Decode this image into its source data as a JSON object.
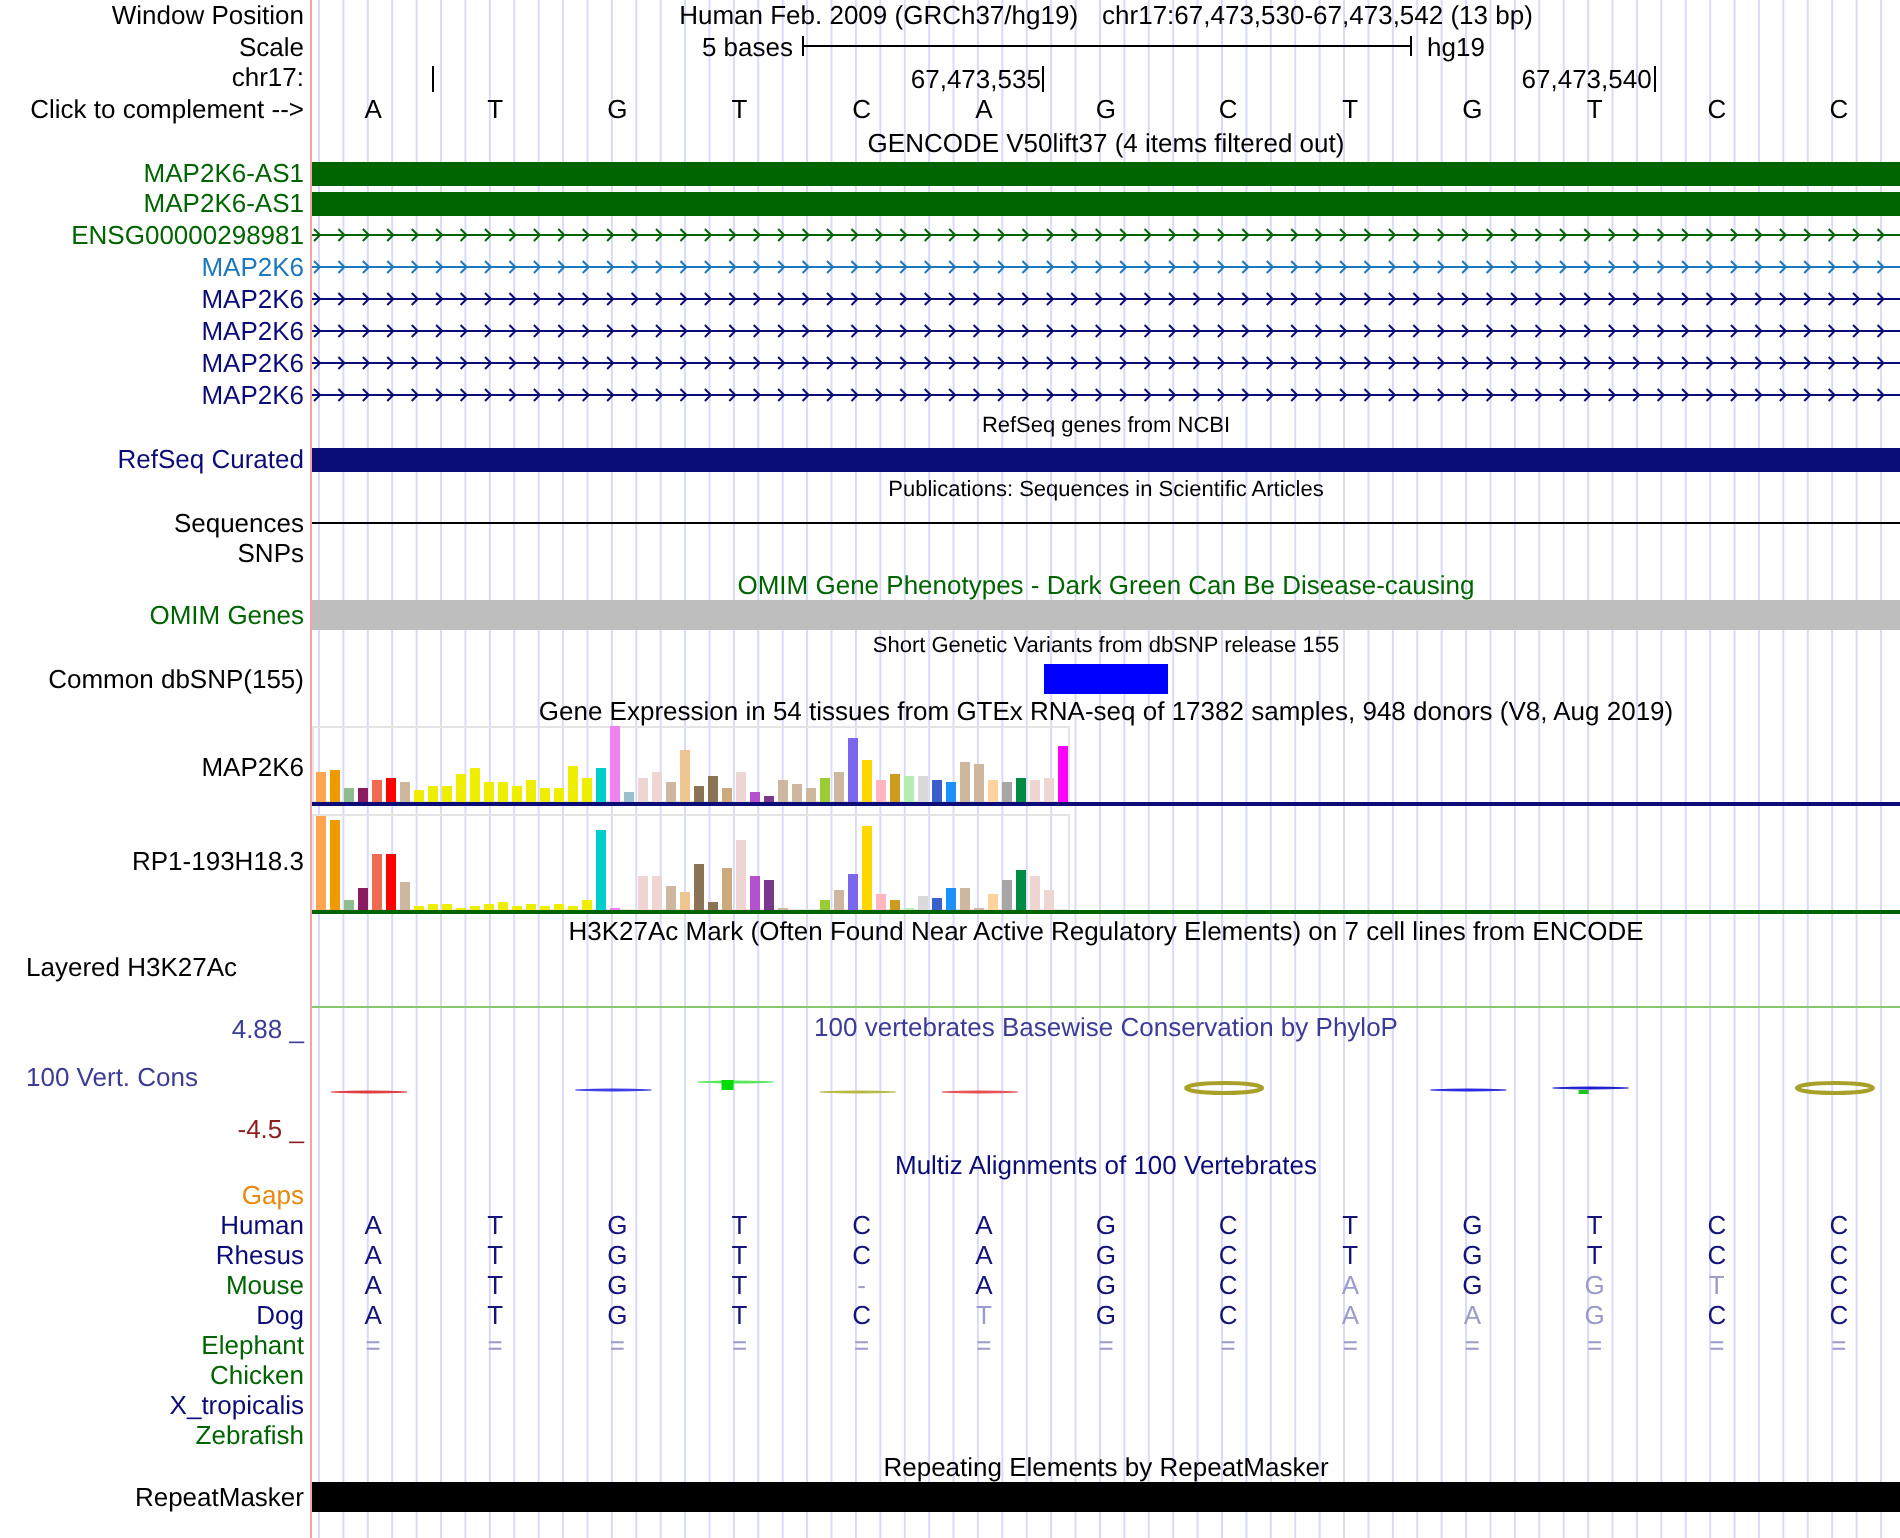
{
  "position": {
    "label": "Window Position",
    "assembly": "Human Feb. 2009 (GRCh37/hg19)",
    "range": "chr17:67,473,530-67,473,542 (13 bp)"
  },
  "scale": {
    "label": "Scale",
    "span": "5 bases",
    "assembly": "hg19"
  },
  "ruler": {
    "label": "chr17:",
    "ticks": [
      "67,473,535",
      "67,473,540"
    ]
  },
  "sequence": {
    "label": "Click to complement -->",
    "bases": [
      "A",
      "T",
      "G",
      "T",
      "C",
      "A",
      "G",
      "C",
      "T",
      "G",
      "T",
      "C",
      "C"
    ]
  },
  "tracks": [
    {
      "kind": "title",
      "text": "GENCODE V50lift37 (4 items filtered out)",
      "color": "#000000"
    },
    {
      "kind": "exon",
      "label": "MAP2K6-AS1",
      "color": "#006400"
    },
    {
      "kind": "exon",
      "label": "MAP2K6-AS1",
      "color": "#006400"
    },
    {
      "kind": "intron",
      "label": "ENSG00000298981",
      "color": "#006400"
    },
    {
      "kind": "intron",
      "label": "MAP2K6",
      "color": "#1e78be"
    },
    {
      "kind": "intron",
      "label": "MAP2K6",
      "color": "#0c0c78"
    },
    {
      "kind": "intron",
      "label": "MAP2K6",
      "color": "#0c0c78"
    },
    {
      "kind": "intron",
      "label": "MAP2K6",
      "color": "#0c0c78"
    },
    {
      "kind": "intron",
      "label": "MAP2K6",
      "color": "#0c0c78"
    },
    {
      "kind": "small_title",
      "text": "RefSeq genes from NCBI",
      "color": "#000000"
    },
    {
      "kind": "exon",
      "label": "RefSeq Curated",
      "color": "#0c0c78"
    },
    {
      "kind": "small_title",
      "text": "Publications: Sequences in Scientific Articles",
      "color": "#000000"
    },
    {
      "kind": "line",
      "label": "Sequences",
      "color": "#000000"
    },
    {
      "kind": "empty",
      "label": "SNPs",
      "color": "#000000"
    },
    {
      "kind": "title",
      "text": "OMIM Gene Phenotypes - Dark Green Can Be Disease-causing",
      "color": "#006400"
    },
    {
      "kind": "block",
      "label": "OMIM Genes",
      "color": "#006400",
      "bar": {
        "color": "#bebebe"
      }
    },
    {
      "kind": "small_title",
      "text": "Short Genetic Variants from dbSNP release 155",
      "color": "#000000"
    },
    {
      "kind": "variant",
      "label": "Common dbSNP(155)",
      "color": "#000000",
      "bar": {
        "color": "#0000ff"
      }
    },
    {
      "kind": "title",
      "text": "Gene Expression in 54 tissues from GTEx RNA-seq of 17382 samples, 948 donors (V8, Aug 2019)",
      "color": "#000000"
    },
    {
      "kind": "expression",
      "label": "MAP2K6",
      "color": "#000000",
      "bar": {
        "color": "#0c0c78"
      }
    },
    {
      "kind": "expression",
      "label": "RP1-193H18.3",
      "color": "#000000",
      "bar": {
        "color": "#006400"
      }
    },
    {
      "kind": "title",
      "text": "H3K27Ac Mark (Often Found Near Active Regulatory Elements) on 7 cell lines from ENCODE",
      "color": "#000000"
    },
    {
      "kind": "signal",
      "label": "Layered H3K27Ac",
      "color": "#000000",
      "bar": {
        "color": "#86c86e"
      }
    },
    {
      "kind": "conservation",
      "title": "100 vertebrates Basewise Conservation by PhyloP",
      "max": "4.88 _",
      "label": "100 Vert. Cons",
      "min": "-4.5 _",
      "color": "#3c3c96"
    },
    {
      "kind": "title",
      "text": "Multiz Alignments of 100 Vertebrates",
      "color": "#0c0c78"
    },
    {
      "kind": "alignment",
      "species": [
        {
          "label": "Gaps",
          "color": "#e8890c"
        },
        {
          "label": "Human",
          "color": "#0c0c78",
          "bases": [
            {
              "base": "A",
              "faded": false
            },
            {
              "base": "T",
              "faded": false
            },
            {
              "base": "G",
              "faded": false
            },
            {
              "base": "T",
              "faded": false
            },
            {
              "base": "C",
              "faded": false
            },
            {
              "base": "A",
              "faded": false
            },
            {
              "base": "G",
              "faded": false
            },
            {
              "base": "C",
              "faded": false
            },
            {
              "base": "T",
              "faded": false
            },
            {
              "base": "G",
              "faded": false
            },
            {
              "base": "T",
              "faded": false
            },
            {
              "base": "C",
              "faded": false
            },
            {
              "base": "C",
              "faded": false
            }
          ]
        },
        {
          "label": "Rhesus",
          "color": "#0c0c78",
          "bases": [
            {
              "base": "A",
              "faded": false
            },
            {
              "base": "T",
              "faded": false
            },
            {
              "base": "G",
              "faded": false
            },
            {
              "base": "T",
              "faded": false
            },
            {
              "base": "C",
              "faded": false
            },
            {
              "base": "A",
              "faded": false
            },
            {
              "base": "G",
              "faded": false
            },
            {
              "base": "C",
              "faded": false
            },
            {
              "base": "T",
              "faded": false
            },
            {
              "base": "G",
              "faded": false
            },
            {
              "base": "T",
              "faded": false
            },
            {
              "base": "C",
              "faded": false
            },
            {
              "base": "C",
              "faded": false
            }
          ]
        },
        {
          "label": "Mouse",
          "color": "#006400",
          "bases": [
            {
              "base": "A",
              "faded": false
            },
            {
              "base": "T",
              "faded": false
            },
            {
              "base": "G",
              "faded": false
            },
            {
              "base": "T",
              "faded": false
            },
            {
              "base": "-",
              "faded": true
            },
            {
              "base": "A",
              "faded": false
            },
            {
              "base": "G",
              "faded": false
            },
            {
              "base": "C",
              "faded": false
            },
            {
              "base": "A",
              "faded": true
            },
            {
              "base": "G",
              "faded": false
            },
            {
              "base": "G",
              "faded": true
            },
            {
              "base": "T",
              "faded": true
            },
            {
              "base": "C",
              "faded": false
            }
          ]
        },
        {
          "label": "Dog",
          "color": "#0c0c78",
          "bases": [
            {
              "base": "A",
              "faded": false
            },
            {
              "base": "T",
              "faded": false
            },
            {
              "base": "G",
              "faded": false
            },
            {
              "base": "T",
              "faded": false
            },
            {
              "base": "C",
              "faded": false
            },
            {
              "base": "T",
              "faded": true
            },
            {
              "base": "G",
              "faded": false
            },
            {
              "base": "C",
              "faded": false
            },
            {
              "base": "A",
              "faded": true
            },
            {
              "base": "A",
              "faded": true
            },
            {
              "base": "G",
              "faded": true
            },
            {
              "base": "C",
              "faded": false
            },
            {
              "base": "C",
              "faded": false
            }
          ]
        },
        {
          "label": "Elephant",
          "color": "#006400",
          "bases": [
            {
              "base": "=",
              "faded": true
            },
            {
              "base": "=",
              "faded": true
            },
            {
              "base": "=",
              "faded": true
            },
            {
              "base": "=",
              "faded": true
            },
            {
              "base": "=",
              "faded": true
            },
            {
              "base": "=",
              "faded": true
            },
            {
              "base": "=",
              "faded": true
            },
            {
              "base": "=",
              "faded": true
            },
            {
              "base": "=",
              "faded": true
            },
            {
              "base": "=",
              "faded": true
            },
            {
              "base": "=",
              "faded": true
            },
            {
              "base": "=",
              "faded": true
            },
            {
              "base": "=",
              "faded": true
            }
          ]
        },
        {
          "label": "Chicken",
          "color": "#006400"
        },
        {
          "label": "X_tropicalis",
          "color": "#0c0c78"
        },
        {
          "label": "Zebrafish",
          "color": "#006400"
        }
      ]
    },
    {
      "kind": "title",
      "text": "Repeating Elements by RepeatMasker",
      "color": "#000000"
    },
    {
      "kind": "block",
      "label": "RepeatMasker",
      "color": "#000000",
      "bar": {
        "color": "#000000"
      }
    }
  ]
}
